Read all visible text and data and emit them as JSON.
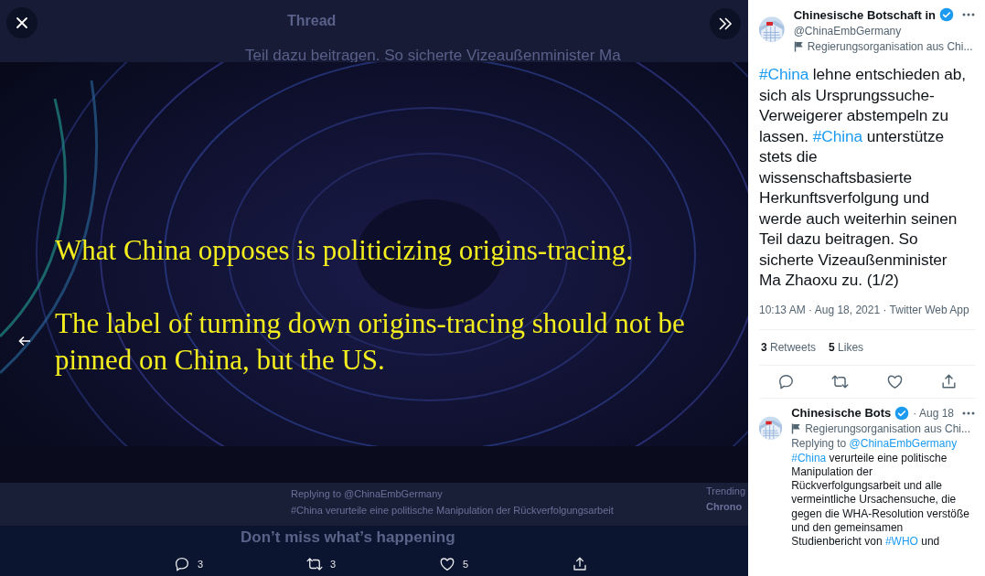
{
  "background_page": {
    "header_title": "Thread",
    "text_line": "Teil dazu beitragen. So sicherte Vizeaußenminister Ma",
    "replying_to": "Replying to @ChinaEmbGermany",
    "reply_text": "#China verurteile eine politische Manipulation der Rückverfolgungsarbeit",
    "banner_title": "Don’t miss what’s happening",
    "trending_label": "Trending",
    "trending_topic": "Chrono"
  },
  "media": {
    "caption_lines": [
      "What China opposes is politicizing origins-tracing.",
      "The label of turning down origins-tracing should not be pinned on China, but the US."
    ]
  },
  "media_actions": [
    {
      "kind": "reply",
      "count": "3"
    },
    {
      "kind": "retweet",
      "count": "3"
    },
    {
      "kind": "like",
      "count": "5"
    },
    {
      "kind": "share"
    }
  ],
  "tweet": {
    "author": "Chinesische Botschaft in",
    "verified": true,
    "handle": "@ChinaEmbGermany",
    "label": "Regierungsorganisation aus Chi...",
    "text": "#China lehne entschieden ab, sich als Ursprungssuche-Verweigerer abstempeln zu lassen. #China unterstütze stets die wissenschaftsbasierte Herkunftsverfolgung und werde auch weiterhin seinen Teil dazu beitragen. So sicherte Vizeaußenminister Ma Zhaoxu zu. (1/2)",
    "meta": "10:13 AM · Aug 18, 2021 · Twitter Web App",
    "stats": [
      {
        "count": "3",
        "label": "Retweets"
      },
      {
        "count": "5",
        "label": "Likes"
      }
    ],
    "actions": [
      {
        "kind": "reply"
      },
      {
        "kind": "retweet"
      },
      {
        "kind": "like"
      },
      {
        "kind": "share"
      }
    ]
  },
  "reply": {
    "author": "Chinesische Bots",
    "verified": true,
    "date": "· Aug 18",
    "label": "Regierungsorganisation aus Chi...",
    "replying_prefix": "Replying to",
    "replying_handle": "@ChinaEmbGermany",
    "text": "#China verurteile eine politische Manipulation der Rückverfolgungsarbeit und alle vermeintliche Ursachensuche, die gegen die WHA-Resolution verstöße und den gemeinsamen Studienbericht von #WHO und"
  }
}
